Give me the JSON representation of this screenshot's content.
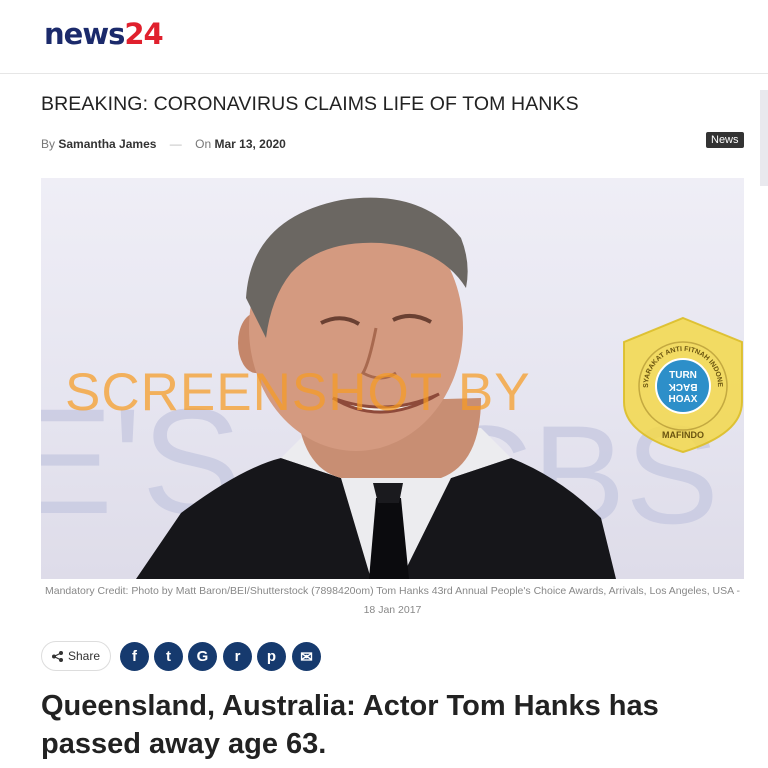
{
  "brand": {
    "name_word": "news",
    "name_number": "24"
  },
  "article": {
    "title": "BREAKING: CORONAVIRUS CLAIMS LIFE OF TOM HANKS",
    "by_label": "By",
    "author": "Samantha James",
    "separator": "—",
    "on_label": "On",
    "date": "Mar 13, 2020",
    "category": "News",
    "photo_caption": "Mandatory Credit: Photo by Matt Baron/BEI/Shutterstock (7898420om) Tom Hanks 43rd Annual People's Choice Awards, Arrivals, Los Angeles, USA - 18 Jan 2017",
    "headline": "Queensland, Australia: Actor Tom Hanks has passed away age 63."
  },
  "photo": {
    "backdrop_text_left": "E'S",
    "backdrop_text_right": "CBS"
  },
  "watermark": {
    "text": "SCREENSHOT BY",
    "seal_text_top": "MASYARAKAT ANTI FITNAH INDONESIA",
    "seal_text_bottom": "MAFINDO",
    "seal_center": [
      "TURN",
      "BACK",
      "HOAX"
    ]
  },
  "share": {
    "label": "Share",
    "buttons": [
      {
        "name": "facebook",
        "glyph": "f",
        "icon": "facebook-icon"
      },
      {
        "name": "twitter",
        "glyph": "t",
        "icon": "twitter-icon"
      },
      {
        "name": "google",
        "glyph": "G",
        "icon": "google-icon"
      },
      {
        "name": "reddit",
        "glyph": "r",
        "icon": "reddit-icon"
      },
      {
        "name": "pinterest",
        "glyph": "p",
        "icon": "pinterest-icon"
      },
      {
        "name": "email",
        "glyph": "✉",
        "icon": "email-icon"
      }
    ]
  },
  "colors": {
    "brand_navy": "#1b2a6b",
    "brand_red": "#e0202d",
    "share_blue": "#163a6e",
    "watermark_orange": "#f69b23",
    "seal_yellow": "#f3d84a"
  }
}
